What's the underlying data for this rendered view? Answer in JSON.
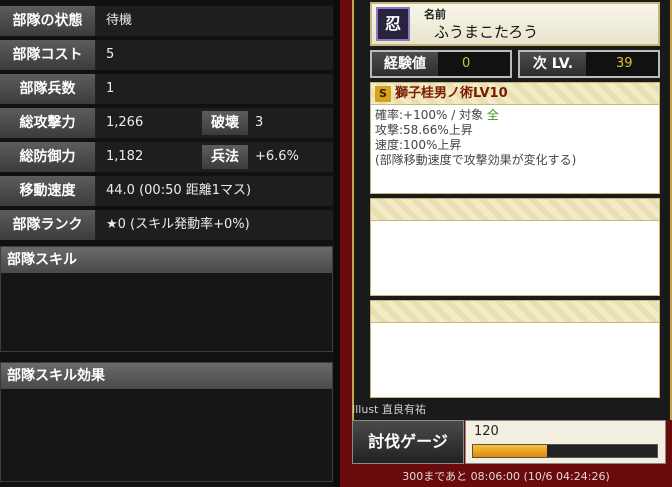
{
  "stats": {
    "status": {
      "label": "部隊の状態",
      "value": "待機"
    },
    "cost": {
      "label": "部隊コスト",
      "value": "5"
    },
    "soldiers": {
      "label": "部隊兵数",
      "value": "1"
    },
    "attack": {
      "label": "総攻撃力",
      "value": "1,266",
      "sub_label": "破壊",
      "sub_value": "3"
    },
    "defense": {
      "label": "総防御力",
      "value": "1,182",
      "sub_label": "兵法",
      "sub_value": "+6.6%"
    },
    "speed": {
      "label": "移動速度",
      "value": "44.0 (00:50 距離1マス)"
    },
    "rank": {
      "label": "部隊ランク",
      "value": "★0 (スキル発動率+0%)"
    }
  },
  "sections": {
    "skill": "部隊スキル",
    "skill_effect": "部隊スキル効果"
  },
  "card": {
    "name_label": "名前",
    "name": "ふうまこたろう",
    "avatar_glyph": "忍",
    "exp_label": "経験値",
    "exp_value": "0",
    "next_label": "次 LV.",
    "next_value": "39",
    "skill_badge": "S",
    "skill_title": "獅子桂男ノ術LV10",
    "skill_lines": [
      "確率:+100% / 対象 全",
      "攻撃:58.66%上昇",
      "速度:100%上昇",
      "(部隊移動速度で攻撃効果が変化する)"
    ],
    "skill_line1_prefix": "確率:+100% / 対象 ",
    "skill_line1_target": "全",
    "illust": "Illust 直良有祐"
  },
  "gauge": {
    "label": "討伐ゲージ",
    "value": "120",
    "fill_fraction": 0.4,
    "footer": "300まであと 08:06:00 (10/6 04:24:26)"
  },
  "colors": {
    "card_bg": "#6b0a0a",
    "gold": "#c9a44c",
    "gauge_fill": "#f7c23a"
  }
}
